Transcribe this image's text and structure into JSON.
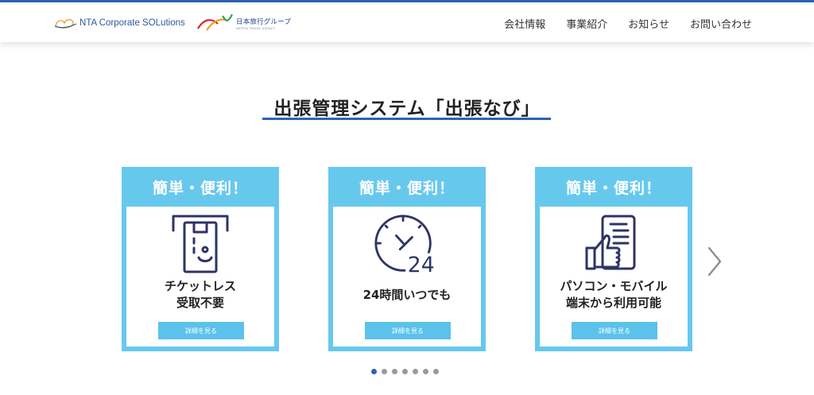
{
  "header": {
    "logo_nta_text": "NTA Corporate SOLutions",
    "logo_group_text": "日本旅行グループ",
    "logo_group_subtext": "NIPPON TRAVEL AGENCY",
    "nav": [
      "会社情報",
      "事業紹介",
      "お知らせ",
      "お問い合わせ"
    ]
  },
  "section": {
    "title": "出張管理システム「出張なび」"
  },
  "cards": [
    {
      "head": "簡単・便利！",
      "line1": "チケットレス",
      "line2": "受取不要",
      "button": "詳細を見る",
      "icon": "atm-ticketless-icon"
    },
    {
      "head": "簡単・便利！",
      "line1": "24時間いつでも",
      "line2": "",
      "button": "詳細を見る",
      "icon": "clock-24-hours-icon"
    },
    {
      "head": "簡単・便利！",
      "line1": "パソコン・モバイル",
      "line2": "端末から利用可能",
      "button": "詳細を見る",
      "icon": "mobile-thumbs-up-icon"
    }
  ],
  "carousel": {
    "dot_count": 7,
    "active_index": 0,
    "next_icon": "chevron-right-icon"
  },
  "colors": {
    "brand_blue": "#2a64b3",
    "card_blue": "#67c8ee",
    "button_blue": "#5bc2ea",
    "icon_navy": "#2d3466"
  }
}
